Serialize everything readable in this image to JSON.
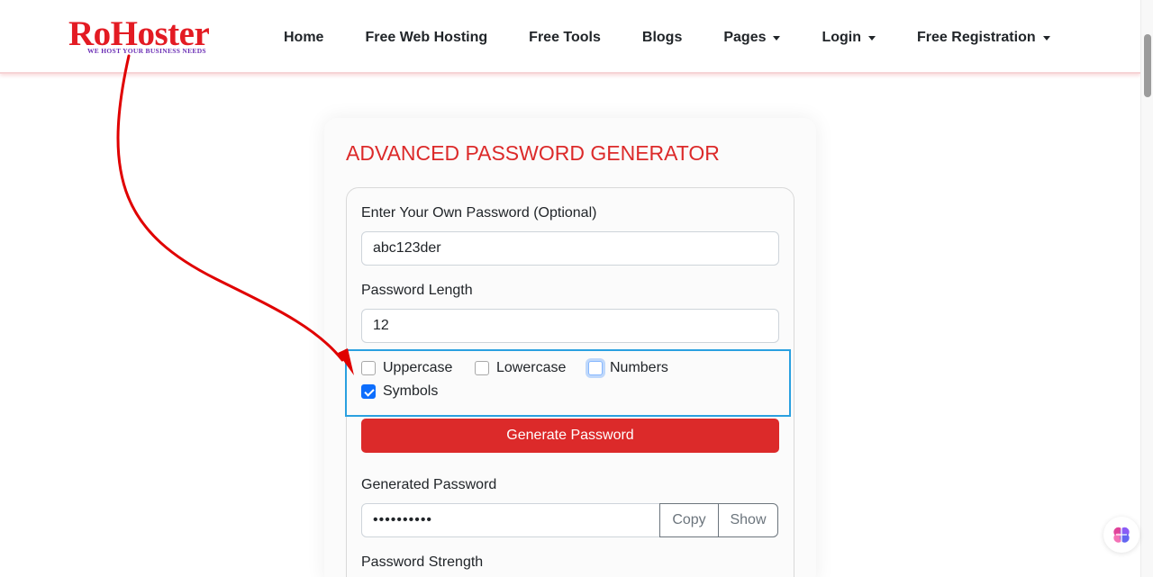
{
  "brand": {
    "logo_text": "RoHoster",
    "tagline": "WE HOST YOUR BUSINESS NEEDS",
    "color": "#e31b23"
  },
  "nav": {
    "items": [
      {
        "label": "Home",
        "dropdown": false
      },
      {
        "label": "Free Web Hosting",
        "dropdown": false
      },
      {
        "label": "Free Tools",
        "dropdown": false
      },
      {
        "label": "Blogs",
        "dropdown": false
      },
      {
        "label": "Pages",
        "dropdown": true
      },
      {
        "label": "Login",
        "dropdown": true
      },
      {
        "label": "Free Registration",
        "dropdown": true
      }
    ]
  },
  "generator": {
    "title": "ADVANCED PASSWORD GENERATOR",
    "own_password_label": "Enter Your Own Password (Optional)",
    "own_password_value": "abc123der",
    "length_label": "Password Length",
    "length_value": "12",
    "options": [
      {
        "label": "Uppercase",
        "checked": false
      },
      {
        "label": "Lowercase",
        "checked": false
      },
      {
        "label": "Numbers",
        "checked": false,
        "focused": true
      },
      {
        "label": "Symbols",
        "checked": true
      }
    ],
    "generate_label": "Generate Password",
    "generated_label": "Generated Password",
    "generated_value": "••••••••••",
    "copy_label": "Copy",
    "show_label": "Show",
    "strength_label": "Password Strength"
  },
  "colors": {
    "accent": "#dc2a2a",
    "highlight_box": "#2aa0e0",
    "annotation_arrow": "#e00000",
    "checkbox_checked": "#0d6efd"
  }
}
